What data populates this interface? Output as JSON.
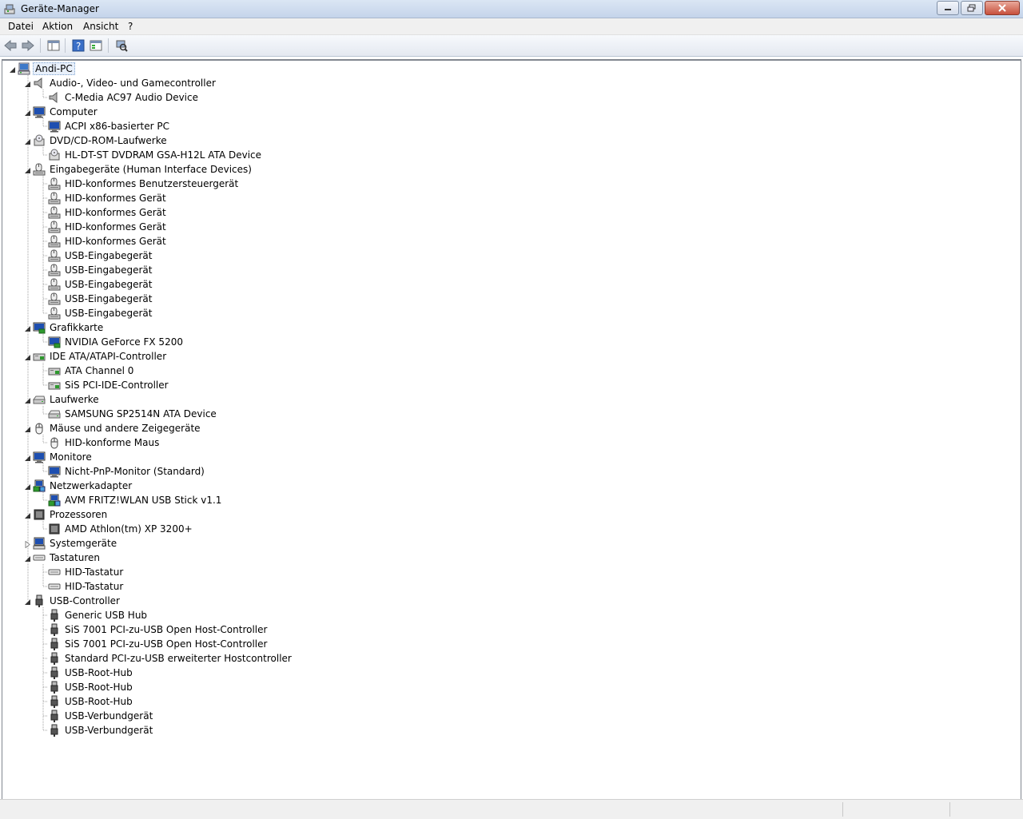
{
  "window": {
    "title": "Geräte-Manager",
    "accent": "#c4d4ea"
  },
  "menubar": {
    "items": [
      {
        "label": "Datei"
      },
      {
        "label": "Aktion"
      },
      {
        "label": "Ansicht"
      },
      {
        "label": "?"
      }
    ]
  },
  "toolbar": {
    "buttons": [
      {
        "icon": "back-arrow-icon"
      },
      {
        "icon": "forward-arrow-icon"
      },
      {
        "icon": "show-hide-console-tree-icon"
      },
      {
        "icon": "help-icon"
      },
      {
        "icon": "properties-icon"
      },
      {
        "icon": "scan-hardware-icon"
      }
    ]
  },
  "tree": {
    "root": {
      "label": "Andi-PC",
      "icon": "computer-icon"
    },
    "categories": [
      {
        "label": "Audio-, Video- und Gamecontroller",
        "icon": "speaker-icon",
        "expanded": true,
        "children": [
          {
            "label": "C-Media AC97 Audio Device",
            "icon": "speaker-icon"
          }
        ]
      },
      {
        "label": "Computer",
        "icon": "monitor-icon",
        "expanded": true,
        "children": [
          {
            "label": "ACPI x86-basierter PC",
            "icon": "monitor-icon"
          }
        ]
      },
      {
        "label": "DVD/CD-ROM-Laufwerke",
        "icon": "optical-drive-icon",
        "expanded": true,
        "children": [
          {
            "label": "HL-DT-ST DVDRAM GSA-H12L ATA Device",
            "icon": "optical-drive-icon"
          }
        ]
      },
      {
        "label": "Eingabegeräte (Human Interface Devices)",
        "icon": "hid-icon",
        "expanded": true,
        "children": [
          {
            "label": "HID-konformes Benutzersteuergerät",
            "icon": "hid-icon"
          },
          {
            "label": "HID-konformes Gerät",
            "icon": "hid-icon"
          },
          {
            "label": "HID-konformes Gerät",
            "icon": "hid-icon"
          },
          {
            "label": "HID-konformes Gerät",
            "icon": "hid-icon"
          },
          {
            "label": "HID-konformes Gerät",
            "icon": "hid-icon"
          },
          {
            "label": "USB-Eingabegerät",
            "icon": "hid-icon"
          },
          {
            "label": "USB-Eingabegerät",
            "icon": "hid-icon"
          },
          {
            "label": "USB-Eingabegerät",
            "icon": "hid-icon"
          },
          {
            "label": "USB-Eingabegerät",
            "icon": "hid-icon"
          },
          {
            "label": "USB-Eingabegerät",
            "icon": "hid-icon"
          }
        ]
      },
      {
        "label": "Grafikkarte",
        "icon": "display-adapter-icon",
        "expanded": true,
        "children": [
          {
            "label": "NVIDIA GeForce FX 5200",
            "icon": "display-adapter-icon"
          }
        ]
      },
      {
        "label": "IDE ATA/ATAPI-Controller",
        "icon": "ide-controller-icon",
        "expanded": true,
        "children": [
          {
            "label": "ATA Channel 0",
            "icon": "ide-controller-icon"
          },
          {
            "label": "SiS PCI-IDE-Controller",
            "icon": "ide-controller-icon"
          }
        ]
      },
      {
        "label": "Laufwerke",
        "icon": "disk-drive-icon",
        "expanded": true,
        "children": [
          {
            "label": "SAMSUNG SP2514N ATA Device",
            "icon": "disk-drive-icon"
          }
        ]
      },
      {
        "label": "Mäuse und andere Zeigegeräte",
        "icon": "mouse-icon",
        "expanded": true,
        "children": [
          {
            "label": "HID-konforme Maus",
            "icon": "mouse-icon"
          }
        ]
      },
      {
        "label": "Monitore",
        "icon": "monitor-icon",
        "expanded": true,
        "children": [
          {
            "label": "Nicht-PnP-Monitor (Standard)",
            "icon": "monitor-icon"
          }
        ]
      },
      {
        "label": "Netzwerkadapter",
        "icon": "network-adapter-icon",
        "expanded": true,
        "children": [
          {
            "label": "AVM FRITZ!WLAN USB Stick v1.1",
            "icon": "network-adapter-icon"
          }
        ]
      },
      {
        "label": "Prozessoren",
        "icon": "processor-icon",
        "expanded": true,
        "children": [
          {
            "label": "AMD Athlon(tm) XP 3200+",
            "icon": "processor-icon"
          }
        ]
      },
      {
        "label": "Systemgeräte",
        "icon": "system-device-icon",
        "expanded": false,
        "children": []
      },
      {
        "label": "Tastaturen",
        "icon": "keyboard-icon",
        "expanded": true,
        "children": [
          {
            "label": "HID-Tastatur",
            "icon": "keyboard-icon"
          },
          {
            "label": "HID-Tastatur",
            "icon": "keyboard-icon"
          }
        ]
      },
      {
        "label": "USB-Controller",
        "icon": "usb-icon",
        "expanded": true,
        "children": [
          {
            "label": "Generic USB Hub",
            "icon": "usb-icon"
          },
          {
            "label": "SiS 7001 PCI-zu-USB Open Host-Controller",
            "icon": "usb-icon"
          },
          {
            "label": "SiS 7001 PCI-zu-USB Open Host-Controller",
            "icon": "usb-icon"
          },
          {
            "label": "Standard PCI-zu-USB erweiterter Hostcontroller",
            "icon": "usb-icon"
          },
          {
            "label": "USB-Root-Hub",
            "icon": "usb-icon"
          },
          {
            "label": "USB-Root-Hub",
            "icon": "usb-icon"
          },
          {
            "label": "USB-Root-Hub",
            "icon": "usb-icon"
          },
          {
            "label": "USB-Verbundgerät",
            "icon": "usb-icon"
          },
          {
            "label": "USB-Verbundgerät",
            "icon": "usb-icon"
          }
        ]
      }
    ]
  }
}
